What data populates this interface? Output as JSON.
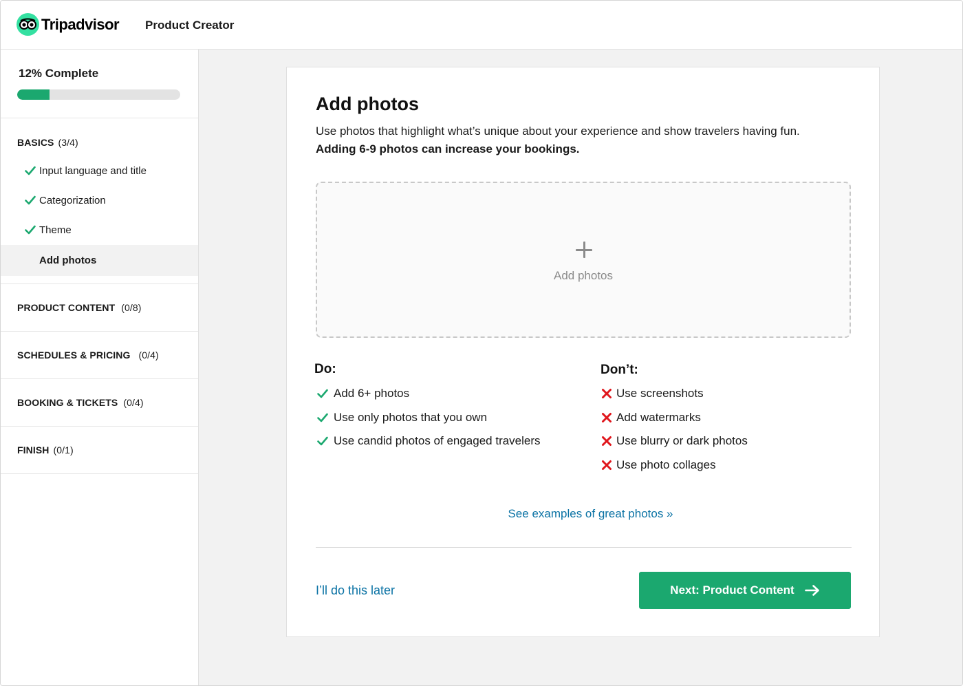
{
  "header": {
    "logo_text": "Tripadvisor",
    "app_title": "Product Creator"
  },
  "sidebar": {
    "progress_label": "12% Complete",
    "progress_value": 0.2,
    "sections": [
      {
        "title": "BASICS",
        "count": "(3/4)"
      },
      {
        "title": "PRODUCT CONTENT",
        "count": "(0/8)"
      },
      {
        "title": "SCHEDULES & PRICING",
        "count": "(0/4)"
      },
      {
        "title": "BOOKING & TICKETS",
        "count": "(0/4)"
      },
      {
        "title": "FINISH",
        "count": "(0/1)"
      }
    ],
    "steps": [
      {
        "label": "Input language and title",
        "done": true
      },
      {
        "label": "Categorization",
        "done": true
      },
      {
        "label": "Theme",
        "done": true
      },
      {
        "label": "Add photos",
        "done": false,
        "active": true
      }
    ]
  },
  "main": {
    "title": "Add photos",
    "description": "Use photos that highlight what’s unique about your experience and show travelers having fun.",
    "description_bold": "Adding 6-9 photos can increase your bookings.",
    "dropzone_label": "Add photos",
    "do_title": "Do:",
    "do_items": [
      "Add 6+ photos",
      "Use only photos that you own",
      "Use candid photos of engaged travelers"
    ],
    "dont_title": "Don’t:",
    "dont_items": [
      "Use screenshots",
      "Add watermarks",
      "Use blurry or dark photos",
      "Use photo collages"
    ],
    "examples_link": "See examples of great photos »",
    "later_link": "I’ll do this later",
    "next_button": "Next: Product Content"
  },
  "colors": {
    "brand_green": "#1ba86f",
    "logo_green": "#34e0a1",
    "link_blue": "#0a72a4",
    "dont_red": "#e0161c"
  }
}
